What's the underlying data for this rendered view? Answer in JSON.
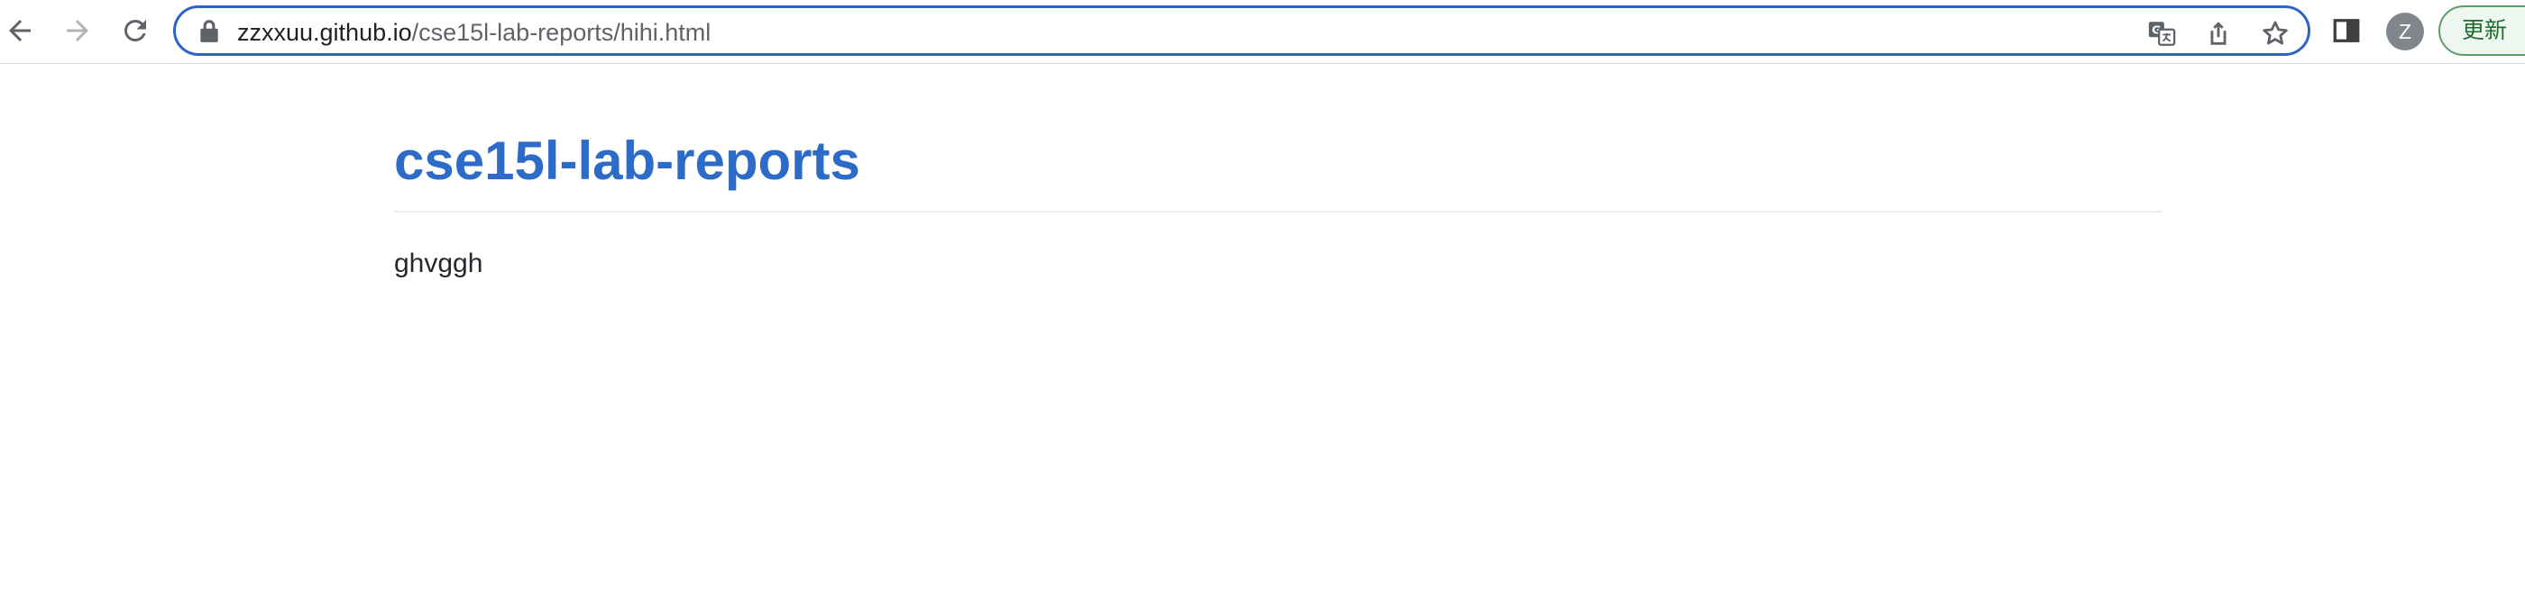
{
  "browser": {
    "url_host": "zzxxuu.github.io",
    "url_path": "/cse15l-lab-reports/hihi.html",
    "profile_initial": "Z",
    "update_label": "更新",
    "icons": {
      "back": "back-arrow-icon",
      "forward": "forward-arrow-icon",
      "reload": "reload-icon",
      "lock": "lock-icon",
      "translate": "translate-icon",
      "share": "share-icon",
      "bookmark": "star-icon",
      "side_panel": "side-panel-icon"
    },
    "colors": {
      "omnibox_border": "#2e63c6",
      "update_border": "#5f9b69"
    }
  },
  "page": {
    "title": "cse15l-lab-reports",
    "body": "ghvggh",
    "colors": {
      "title": "#2c6bc8",
      "text": "#24292e"
    }
  }
}
